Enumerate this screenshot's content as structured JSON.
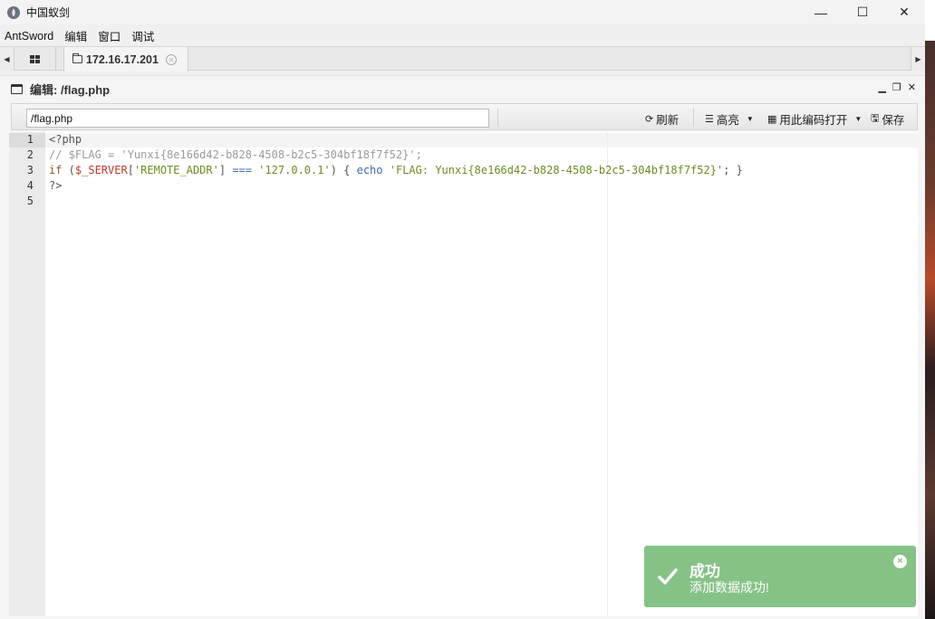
{
  "window": {
    "title": "中国蚁剑",
    "minimize": "—",
    "maximize": "☐",
    "close": "✕"
  },
  "menubar": {
    "items": [
      "AntSword",
      "编辑",
      "窗口",
      "调试"
    ]
  },
  "tabs": {
    "active_label": "172.16.17.201",
    "close_glyph": "×"
  },
  "panel": {
    "title": "编辑: /flag.php",
    "ctrl_min": "▁",
    "ctrl_restore": "❐",
    "ctrl_close": "✕"
  },
  "toolbar": {
    "path_value": "/flag.php",
    "refresh_label": "刷新",
    "highlight_label": "高亮",
    "open_with_encoding_label": "用此编码打开",
    "save_label": "保存"
  },
  "editor": {
    "line_numbers": [
      "1",
      "2",
      "3",
      "4",
      "5"
    ],
    "line1": "<?php",
    "line2": "// $FLAG = 'Yunxi{8e166d42-b828-4508-b2c5-304bf18f7f52}';",
    "line3": {
      "kw_if": "if",
      "paren_open": " (",
      "var_server": "$_SERVER",
      "bracket_open": "[",
      "str_key": "'REMOTE_ADDR'",
      "bracket_close": "]",
      "op": " === ",
      "str_ip": "'127.0.0.1'",
      "paren_close": ") { ",
      "echo": "echo",
      "str_flag": " 'FLAG: Yunxi{8e166d42-b828-4508-b2c5-304bf18f7f52}'",
      "tail": "; }"
    },
    "line4": "?>",
    "line5": ""
  },
  "toast": {
    "title": "成功",
    "message": "添加数据成功!",
    "close_glyph": "×",
    "color": "#86c286"
  }
}
